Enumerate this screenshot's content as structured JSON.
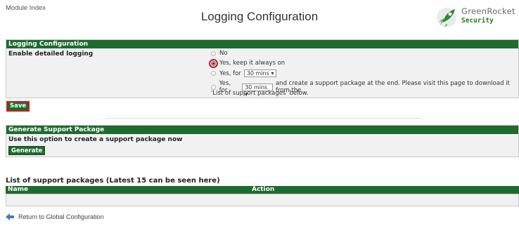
{
  "header": {
    "module_index": "Module Index",
    "title": "Logging Configuration",
    "logo": {
      "name": "GreenRocket",
      "tagline": "Security"
    }
  },
  "logging": {
    "section_title": "Logging Configuration",
    "field_label": "Enable detailed logging",
    "options": {
      "no": "No",
      "always_on": "Yes, keep it always on",
      "for_prefix": "Yes, for",
      "duration_1": "30 mins",
      "duration_2": "30 mins",
      "package_text": "and create a support package at the end. Please visit this page to download it from the",
      "package_text_2": "'List of support packages' below."
    },
    "selected": "always_on",
    "save_label": "Save"
  },
  "support": {
    "section_title": "Generate Support Package",
    "description": "Use this option to create a support package now",
    "generate_label": "Generate"
  },
  "packages": {
    "title": "List of support packages (Latest 15 can be seen here)",
    "columns": [
      "Name",
      "Action"
    ],
    "rows": []
  },
  "footer": {
    "return_label": "Return to Global Configuration"
  },
  "colors": {
    "header_green": "#1e6b2e",
    "highlight_red": "#d2191f",
    "panel_bg": "#f1f1f1"
  }
}
